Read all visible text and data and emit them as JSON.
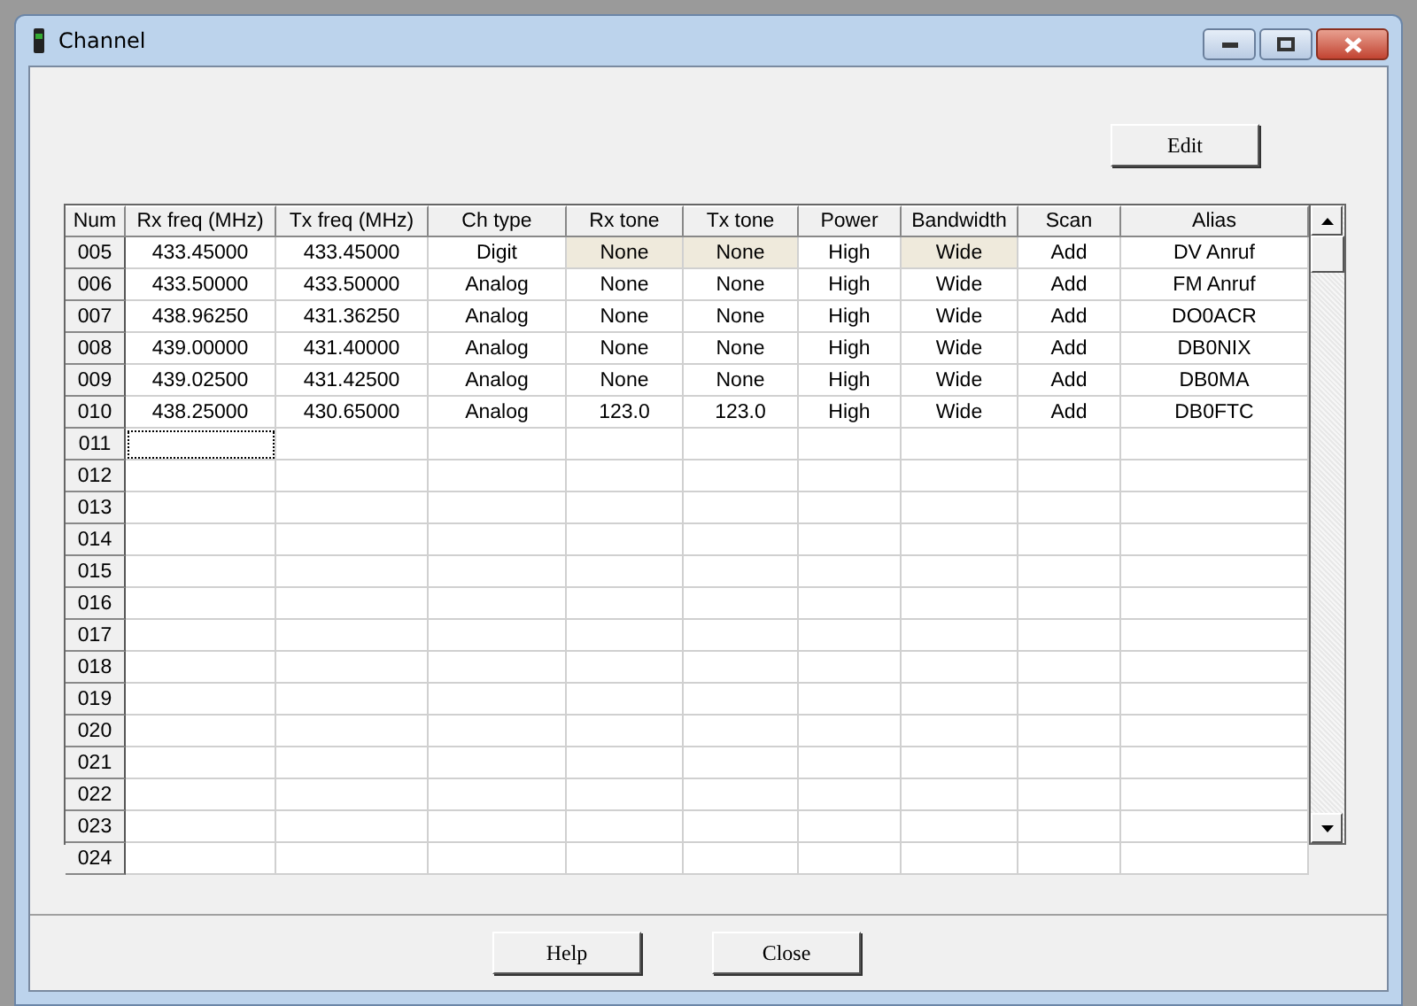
{
  "window": {
    "title": "Channel"
  },
  "edit_button": "Edit",
  "table": {
    "columns": [
      "Num",
      "Rx freq (MHz)",
      "Tx freq (MHz)",
      "Ch type",
      "Rx tone",
      "Tx tone",
      "Power",
      "Bandwidth",
      "Scan",
      "Alias"
    ],
    "rows": [
      {
        "num": "005",
        "focused": false,
        "cells": [
          {
            "text": "433.45000",
            "highlighted": false
          },
          {
            "text": "433.45000",
            "highlighted": false
          },
          {
            "text": "Digit",
            "highlighted": false
          },
          {
            "text": "None",
            "highlighted": true
          },
          {
            "text": "None",
            "highlighted": true
          },
          {
            "text": "High",
            "highlighted": false
          },
          {
            "text": "Wide",
            "highlighted": true
          },
          {
            "text": "Add",
            "highlighted": false
          },
          {
            "text": "DV Anruf",
            "highlighted": false
          }
        ]
      },
      {
        "num": "006",
        "focused": false,
        "cells": [
          {
            "text": "433.50000",
            "highlighted": false
          },
          {
            "text": "433.50000",
            "highlighted": false
          },
          {
            "text": "Analog",
            "highlighted": false
          },
          {
            "text": "None",
            "highlighted": false
          },
          {
            "text": "None",
            "highlighted": false
          },
          {
            "text": "High",
            "highlighted": false
          },
          {
            "text": "Wide",
            "highlighted": false
          },
          {
            "text": "Add",
            "highlighted": false
          },
          {
            "text": "FM Anruf",
            "highlighted": false
          }
        ]
      },
      {
        "num": "007",
        "focused": false,
        "cells": [
          {
            "text": "438.96250",
            "highlighted": false
          },
          {
            "text": "431.36250",
            "highlighted": false
          },
          {
            "text": "Analog",
            "highlighted": false
          },
          {
            "text": "None",
            "highlighted": false
          },
          {
            "text": "None",
            "highlighted": false
          },
          {
            "text": "High",
            "highlighted": false
          },
          {
            "text": "Wide",
            "highlighted": false
          },
          {
            "text": "Add",
            "highlighted": false
          },
          {
            "text": "DO0ACR",
            "highlighted": false
          }
        ]
      },
      {
        "num": "008",
        "focused": false,
        "cells": [
          {
            "text": "439.00000",
            "highlighted": false
          },
          {
            "text": "431.40000",
            "highlighted": false
          },
          {
            "text": "Analog",
            "highlighted": false
          },
          {
            "text": "None",
            "highlighted": false
          },
          {
            "text": "None",
            "highlighted": false
          },
          {
            "text": "High",
            "highlighted": false
          },
          {
            "text": "Wide",
            "highlighted": false
          },
          {
            "text": "Add",
            "highlighted": false
          },
          {
            "text": "DB0NIX",
            "highlighted": false
          }
        ]
      },
      {
        "num": "009",
        "focused": false,
        "cells": [
          {
            "text": "439.02500",
            "highlighted": false
          },
          {
            "text": "431.42500",
            "highlighted": false
          },
          {
            "text": "Analog",
            "highlighted": false
          },
          {
            "text": "None",
            "highlighted": false
          },
          {
            "text": "None",
            "highlighted": false
          },
          {
            "text": "High",
            "highlighted": false
          },
          {
            "text": "Wide",
            "highlighted": false
          },
          {
            "text": "Add",
            "highlighted": false
          },
          {
            "text": "DB0MA",
            "highlighted": false
          }
        ]
      },
      {
        "num": "010",
        "focused": false,
        "cells": [
          {
            "text": "438.25000",
            "highlighted": false
          },
          {
            "text": "430.65000",
            "highlighted": false
          },
          {
            "text": "Analog",
            "highlighted": false
          },
          {
            "text": "123.0",
            "highlighted": false
          },
          {
            "text": "123.0",
            "highlighted": false
          },
          {
            "text": "High",
            "highlighted": false
          },
          {
            "text": "Wide",
            "highlighted": false
          },
          {
            "text": "Add",
            "highlighted": false
          },
          {
            "text": "DB0FTC",
            "highlighted": false
          }
        ]
      },
      {
        "num": "011",
        "focused": true
      },
      {
        "num": "012",
        "focused": false
      },
      {
        "num": "013",
        "focused": false
      },
      {
        "num": "014",
        "focused": false
      },
      {
        "num": "015",
        "focused": false
      },
      {
        "num": "016",
        "focused": false
      },
      {
        "num": "017",
        "focused": false
      },
      {
        "num": "018",
        "focused": false
      },
      {
        "num": "019",
        "focused": false
      },
      {
        "num": "020",
        "focused": false
      },
      {
        "num": "021",
        "focused": false
      },
      {
        "num": "022",
        "focused": false
      },
      {
        "num": "023",
        "focused": false
      },
      {
        "num": "024",
        "focused": false
      }
    ]
  },
  "buttons": [
    "Help",
    "Close"
  ]
}
